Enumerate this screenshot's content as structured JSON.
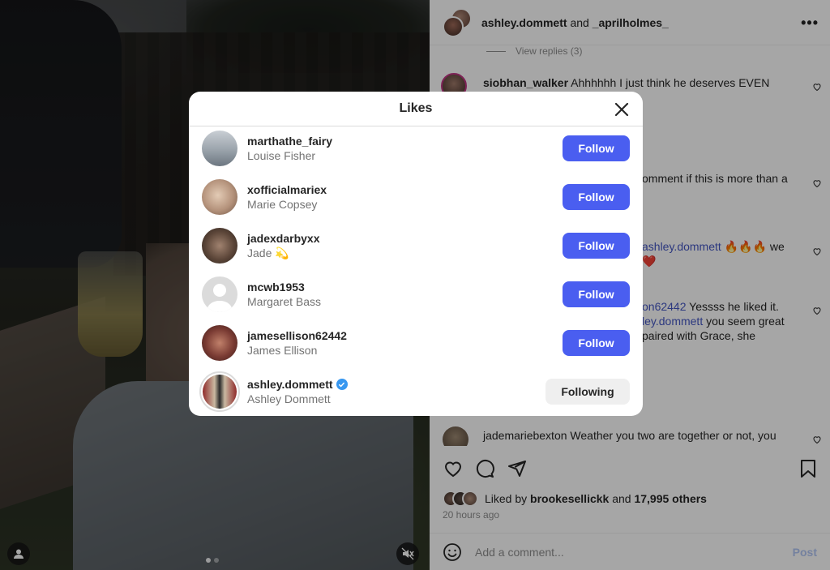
{
  "post": {
    "header_user1": "ashley.dommett",
    "header_and": "and",
    "header_user2": "_aprilholmes_",
    "more_icon": "more-horizontal-icon"
  },
  "comments": {
    "view_replies": "View replies (3)",
    "items": [
      {
        "user": "siobhan_walker",
        "text": "Ahhhhhh I just think he deserves EVEN"
      },
      {
        "text": "omment if this is more than a"
      },
      {
        "mention": "ashley.dommett",
        "text": "🔥🔥🔥 we",
        "text2": "❤️"
      },
      {
        "mention": "on62442",
        "text": "Yessss he liked it.",
        "mention2": "ley.dommett",
        "text2": "you seem great",
        "text3": "paired with Grace, she"
      },
      {
        "user": "jademariebexton",
        "text": "Weather you two are together or not, you"
      }
    ]
  },
  "actions": {
    "like_icon": "heart-icon",
    "comment_icon": "comment-icon",
    "share_icon": "send-icon",
    "save_icon": "bookmark-icon"
  },
  "likes_summary": {
    "prefix": "Liked by",
    "user": "brookesellickk",
    "and": "and",
    "others": "17,995 others",
    "time_ago": "20 hours ago"
  },
  "comment_box": {
    "placeholder": "Add a comment...",
    "post_label": "Post"
  },
  "modal": {
    "title": "Likes",
    "users": [
      {
        "username": "marthathe_fairy",
        "name": "Louise Fisher",
        "button": "Follow",
        "verified": false
      },
      {
        "username": "xofficialmariex",
        "name": "Marie Copsey",
        "button": "Follow",
        "verified": false
      },
      {
        "username": "jadexdarbyxx",
        "name": "Jade 💫",
        "button": "Follow",
        "verified": false
      },
      {
        "username": "mcwb1953",
        "name": "Margaret Bass",
        "button": "Follow",
        "verified": false
      },
      {
        "username": "jamesellison62442",
        "name": "James Ellison",
        "button": "Follow",
        "verified": false
      },
      {
        "username": "ashley.dommett",
        "name": "Ashley Dommett",
        "button": "Following",
        "verified": true
      }
    ]
  },
  "colors": {
    "follow_button": "#4a5ef0",
    "following_button": "#efefef",
    "verified_badge": "#3797f0",
    "mention": "#4457c4"
  }
}
